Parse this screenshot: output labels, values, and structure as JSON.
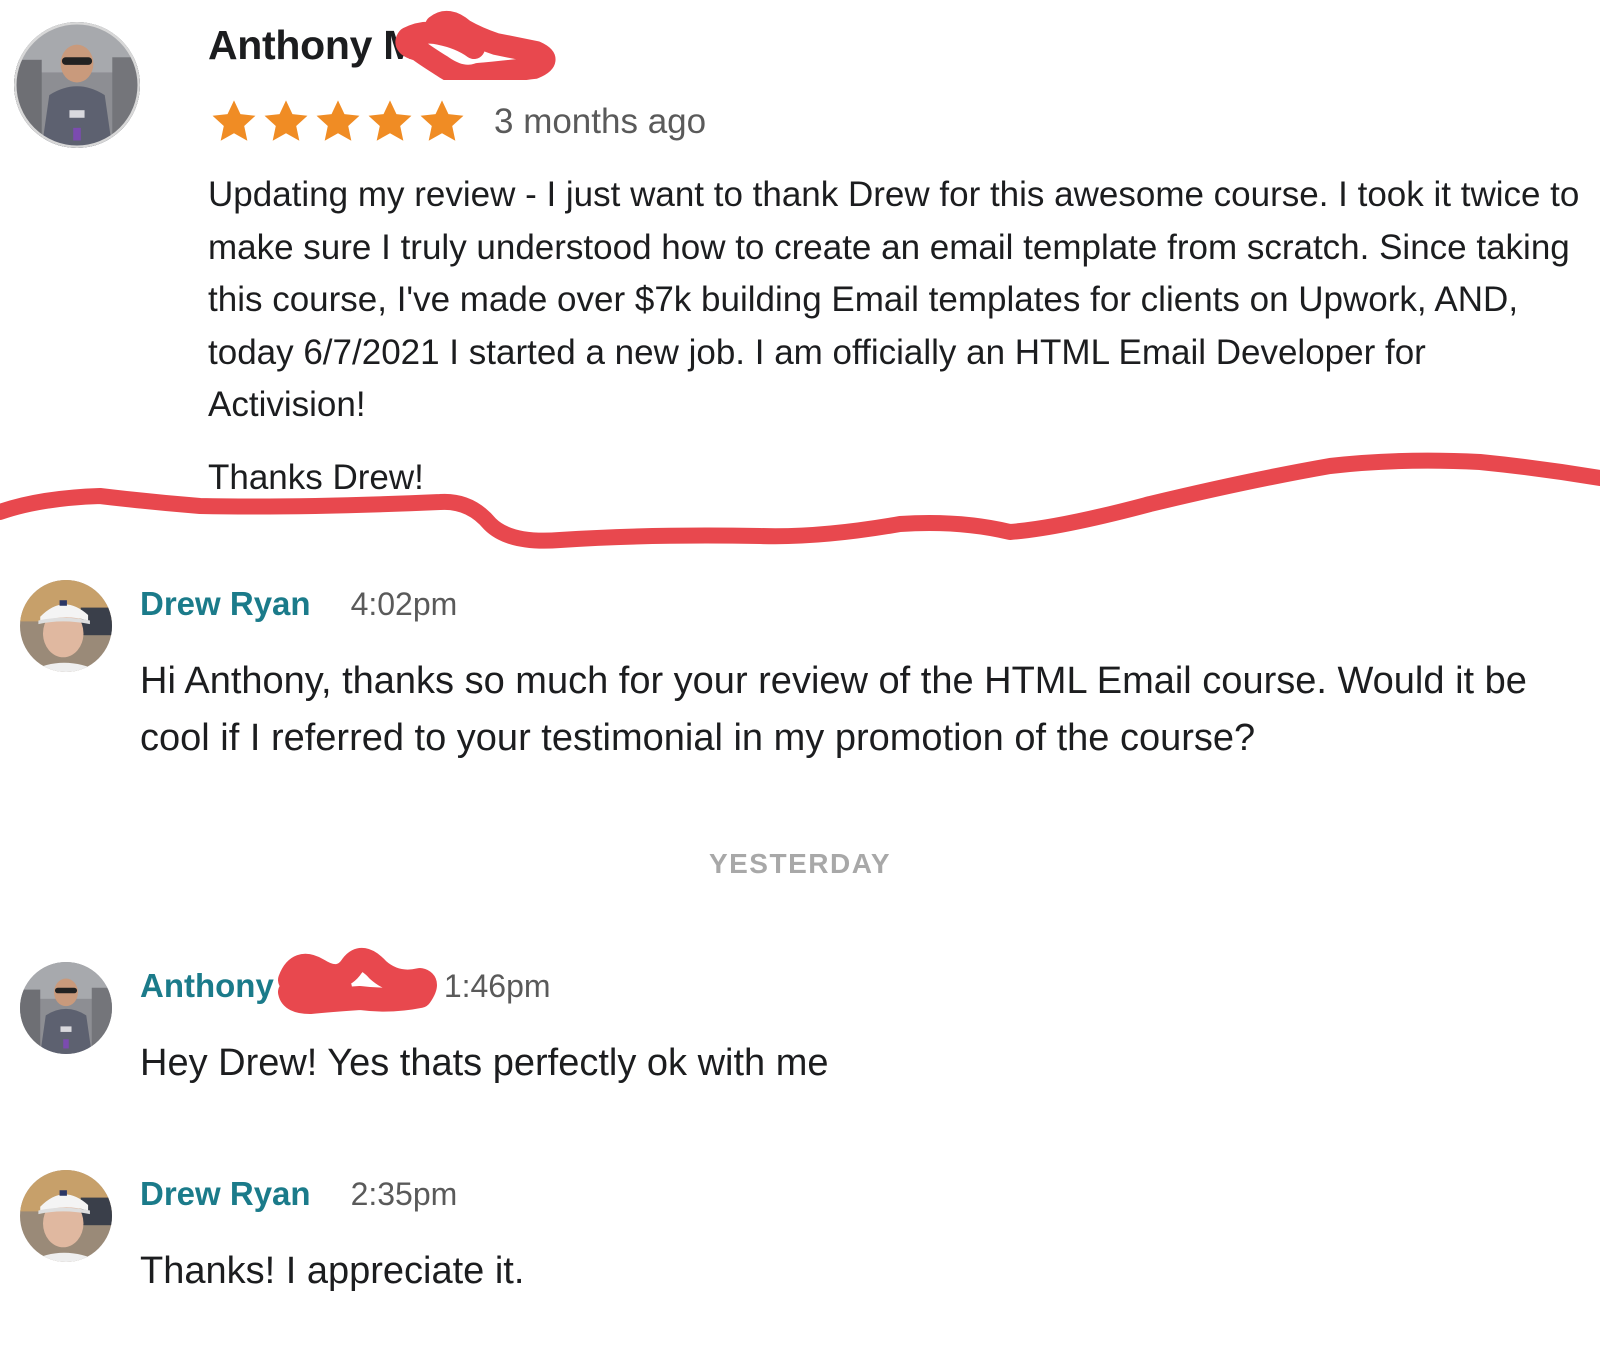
{
  "review": {
    "reviewer_name": "Anthony M",
    "rating": 5,
    "rating_max": 5,
    "date": "3 months ago",
    "body": "Updating my review - I just want to thank Drew for this awesome course. I took it twice to make sure I truly understood how to create an email template from scratch. Since taking this course, I've made over $7k building Email templates for clients on Upwork, AND, today 6/7/2021 I started a new job. I am officially an HTML Email Developer for Activision!",
    "closing": "Thanks Drew!"
  },
  "chat": {
    "messages": [
      {
        "sender": "Drew Ryan",
        "time": "4:02pm",
        "text": "Hi Anthony, thanks so much for your review of the HTML Email course. Would it be cool if I referred to your testimonial in my promotion of the course?"
      },
      {
        "sender": "Anthony",
        "time": "1:46pm",
        "text": "Hey Drew! Yes thats perfectly ok with me"
      },
      {
        "sender": "Drew Ryan",
        "time": "2:35pm",
        "text": "Thanks! I appreciate it."
      }
    ],
    "day_divider": "YESTERDAY"
  },
  "colors": {
    "star": "#f08c24",
    "sender_name": "#1b7b8a",
    "redaction": "#e8484e",
    "muted_text": "#5a5a5a",
    "divider_text": "#a8a8a8"
  },
  "icons": {
    "star": "star-icon",
    "avatar_anthony": "avatar-anthony",
    "avatar_drew": "avatar-drew-ryan"
  }
}
